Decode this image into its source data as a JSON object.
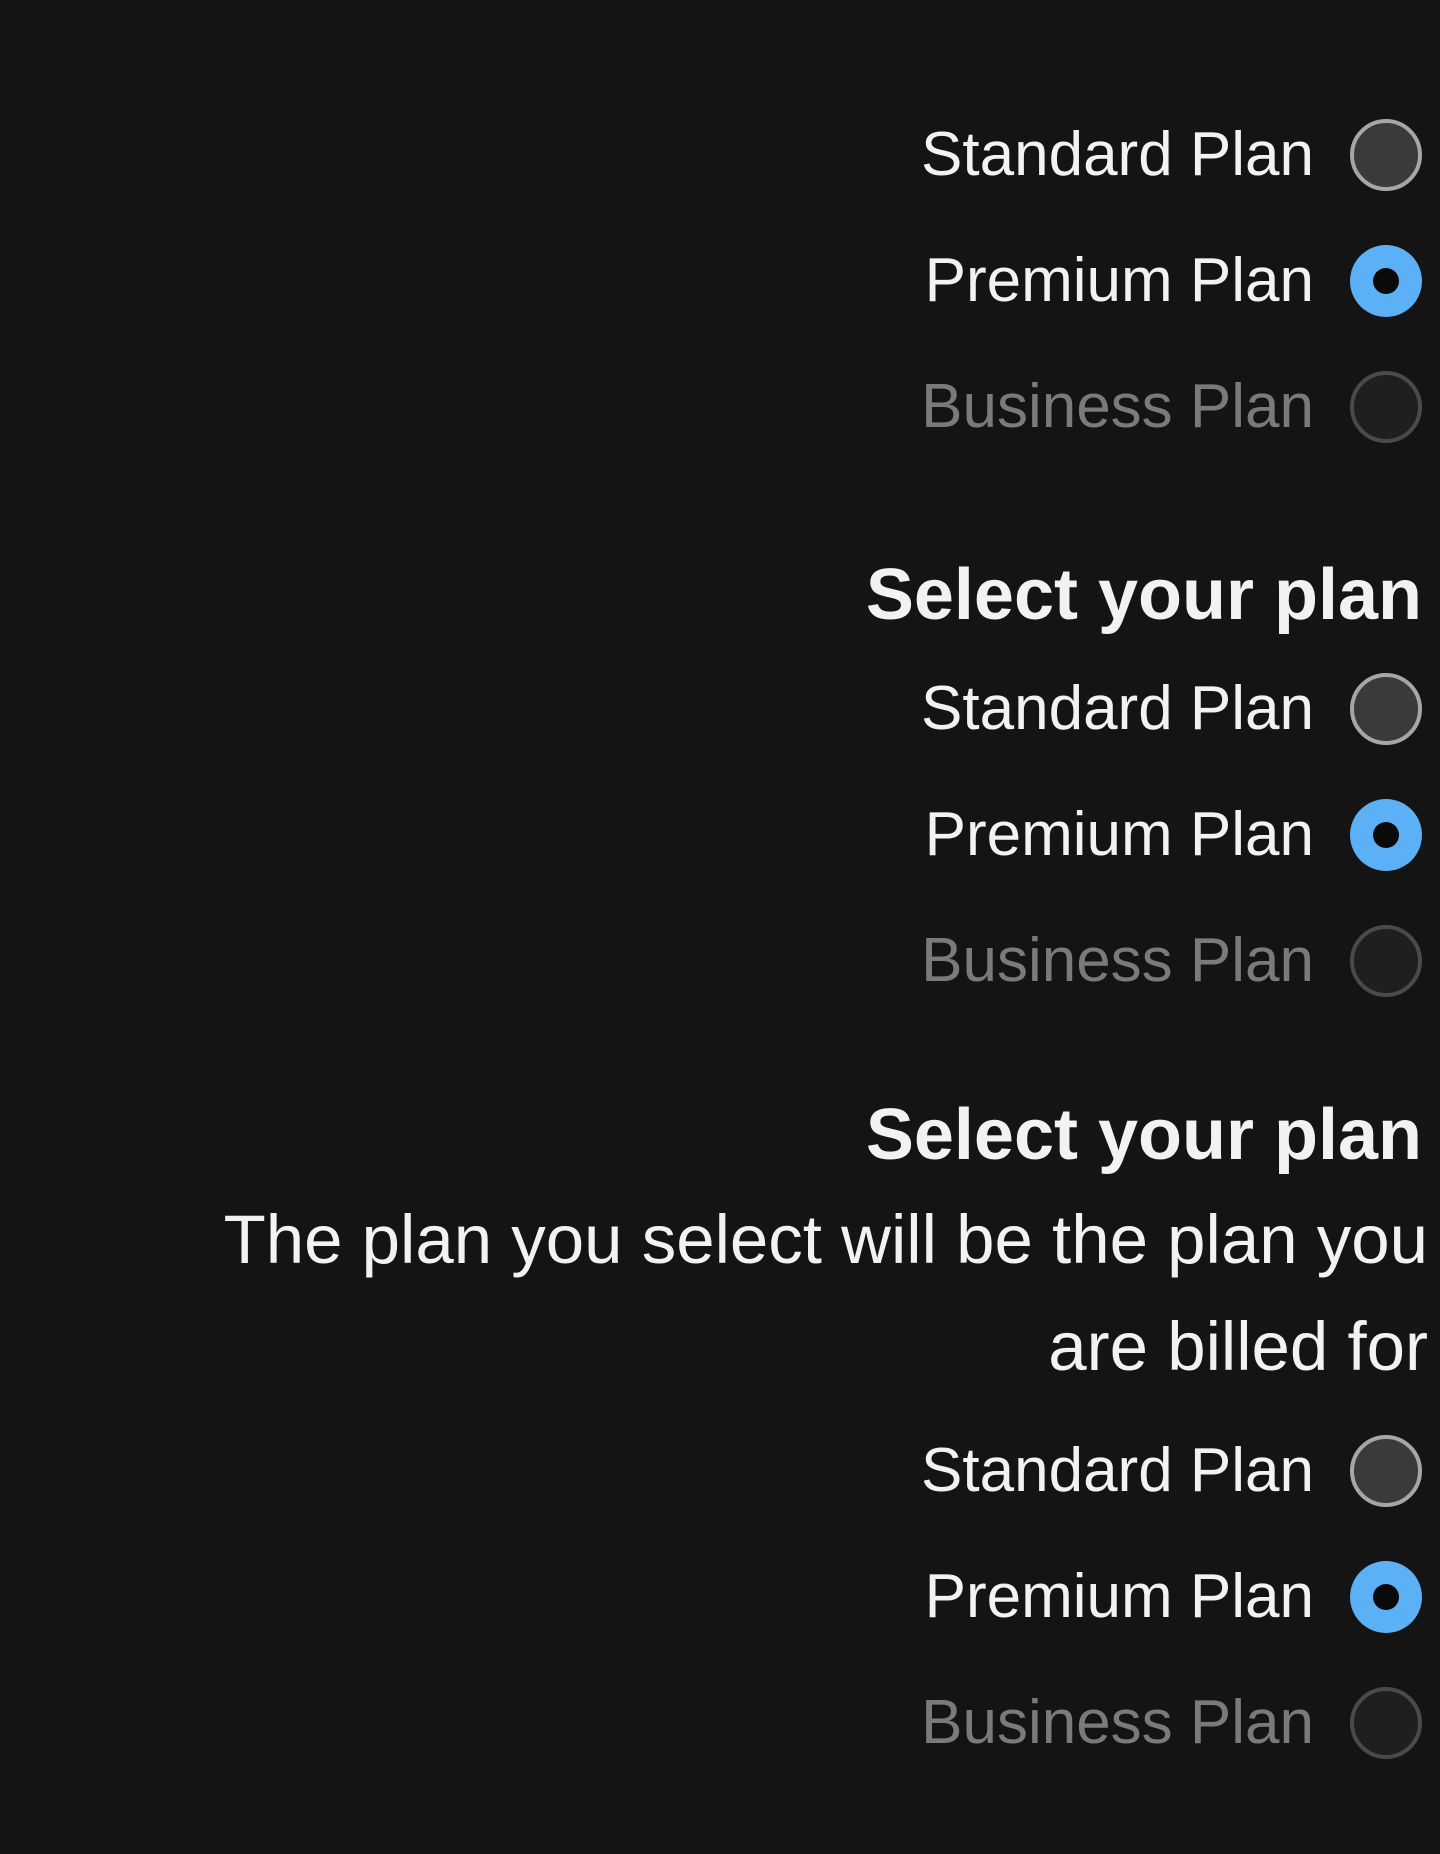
{
  "colors": {
    "background": "#141415",
    "text": "#f2f2f2",
    "disabled_text": "#7a7a7c",
    "accent": "#5cb0f6"
  },
  "groups": [
    {
      "options": [
        {
          "label": "Standard Plan",
          "state": "unchecked"
        },
        {
          "label": "Premium Plan",
          "state": "checked"
        },
        {
          "label": "Business Plan",
          "state": "disabled"
        }
      ]
    },
    {
      "title": "Select your plan",
      "options": [
        {
          "label": "Standard Plan",
          "state": "unchecked"
        },
        {
          "label": "Premium Plan",
          "state": "checked"
        },
        {
          "label": "Business Plan",
          "state": "disabled"
        }
      ]
    },
    {
      "title": "Select your plan",
      "description": "The plan you select will be the plan you are billed for",
      "options": [
        {
          "label": "Standard Plan",
          "state": "unchecked"
        },
        {
          "label": "Premium Plan",
          "state": "checked"
        },
        {
          "label": "Business Plan",
          "state": "disabled"
        }
      ]
    }
  ]
}
